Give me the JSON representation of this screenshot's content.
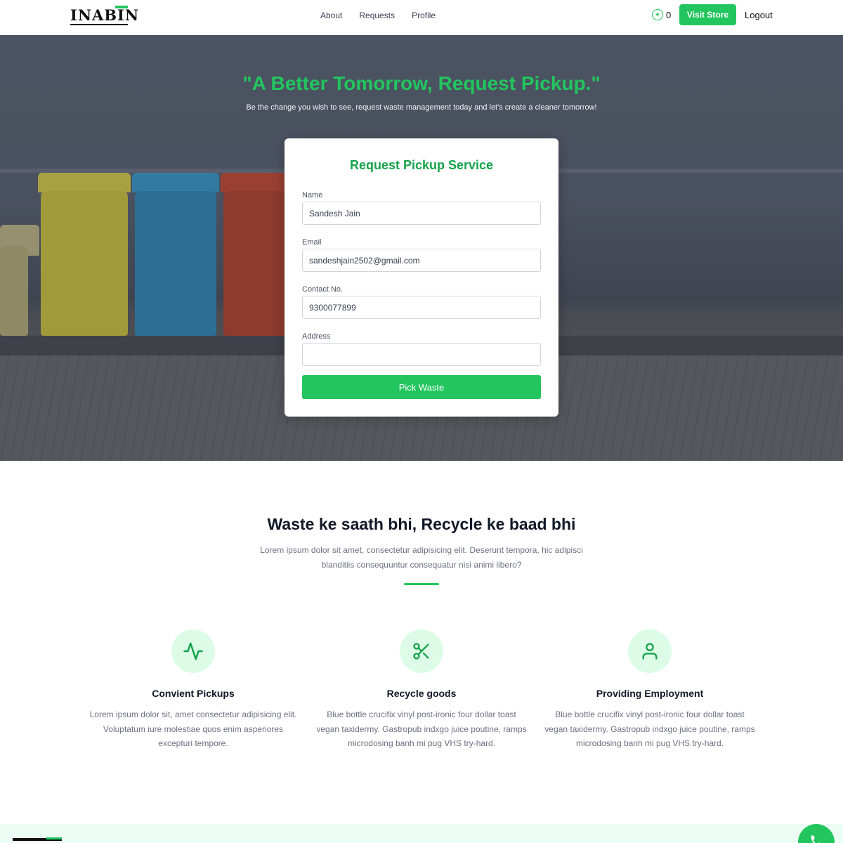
{
  "nav": {
    "logo_text": "INABIN",
    "links": [
      "About",
      "Requests",
      "Profile"
    ],
    "points": "0",
    "visit_store": "Visit Store",
    "logout": "Logout"
  },
  "hero": {
    "title": "\"A Better Tomorrow, Request Pickup.\"",
    "subtitle": "Be the change you wish to see, request waste management today and let's create a cleaner tomorrow!"
  },
  "form": {
    "title": "Request Pickup Service",
    "name_label": "Name",
    "name_value": "Sandesh Jain",
    "email_label": "Email",
    "email_value": "sandeshjain2502@gmail.com",
    "contact_label": "Contact No.",
    "contact_value": "9300077899",
    "address_label": "Address",
    "address_value": "",
    "submit": "Pick Waste"
  },
  "features_section": {
    "title": "Waste ke saath bhi, Recycle ke baad bhi",
    "description": "Lorem ipsum dolor sit amet, consectetur adipisicing elit. Deserunt tempora, hic adipisci blanditiis consequuntur consequatur nisi animi libero?",
    "items": [
      {
        "icon": "activity-icon",
        "title": "Convient Pickups",
        "text": "Lorem ipsum dolor sit, amet consectetur adipisicing elit. Voluptatum iure molestiae quos enim asperiores excepturi tempore."
      },
      {
        "icon": "scissors-icon",
        "title": "Recycle goods",
        "text": "Blue bottle crucifix vinyl post-ironic four dollar toast vegan taxidermy. Gastropub indxgo juice poutine, ramps microdosing banh mi pug VHS try-hard."
      },
      {
        "icon": "user-icon",
        "title": "Providing Employment",
        "text": "Blue bottle crucifix vinyl post-ironic four dollar toast vegan taxidermy. Gastropub indxgo juice poutine, ramps microdosing banh mi pug VHS try-hard."
      }
    ]
  },
  "colors": {
    "accent": "#22c55e",
    "accent_dark": "#16a34a",
    "icon_bg": "#dcfce7",
    "footer_bg": "#ecfdf3"
  },
  "floating": {
    "icon": "phone-icon"
  }
}
